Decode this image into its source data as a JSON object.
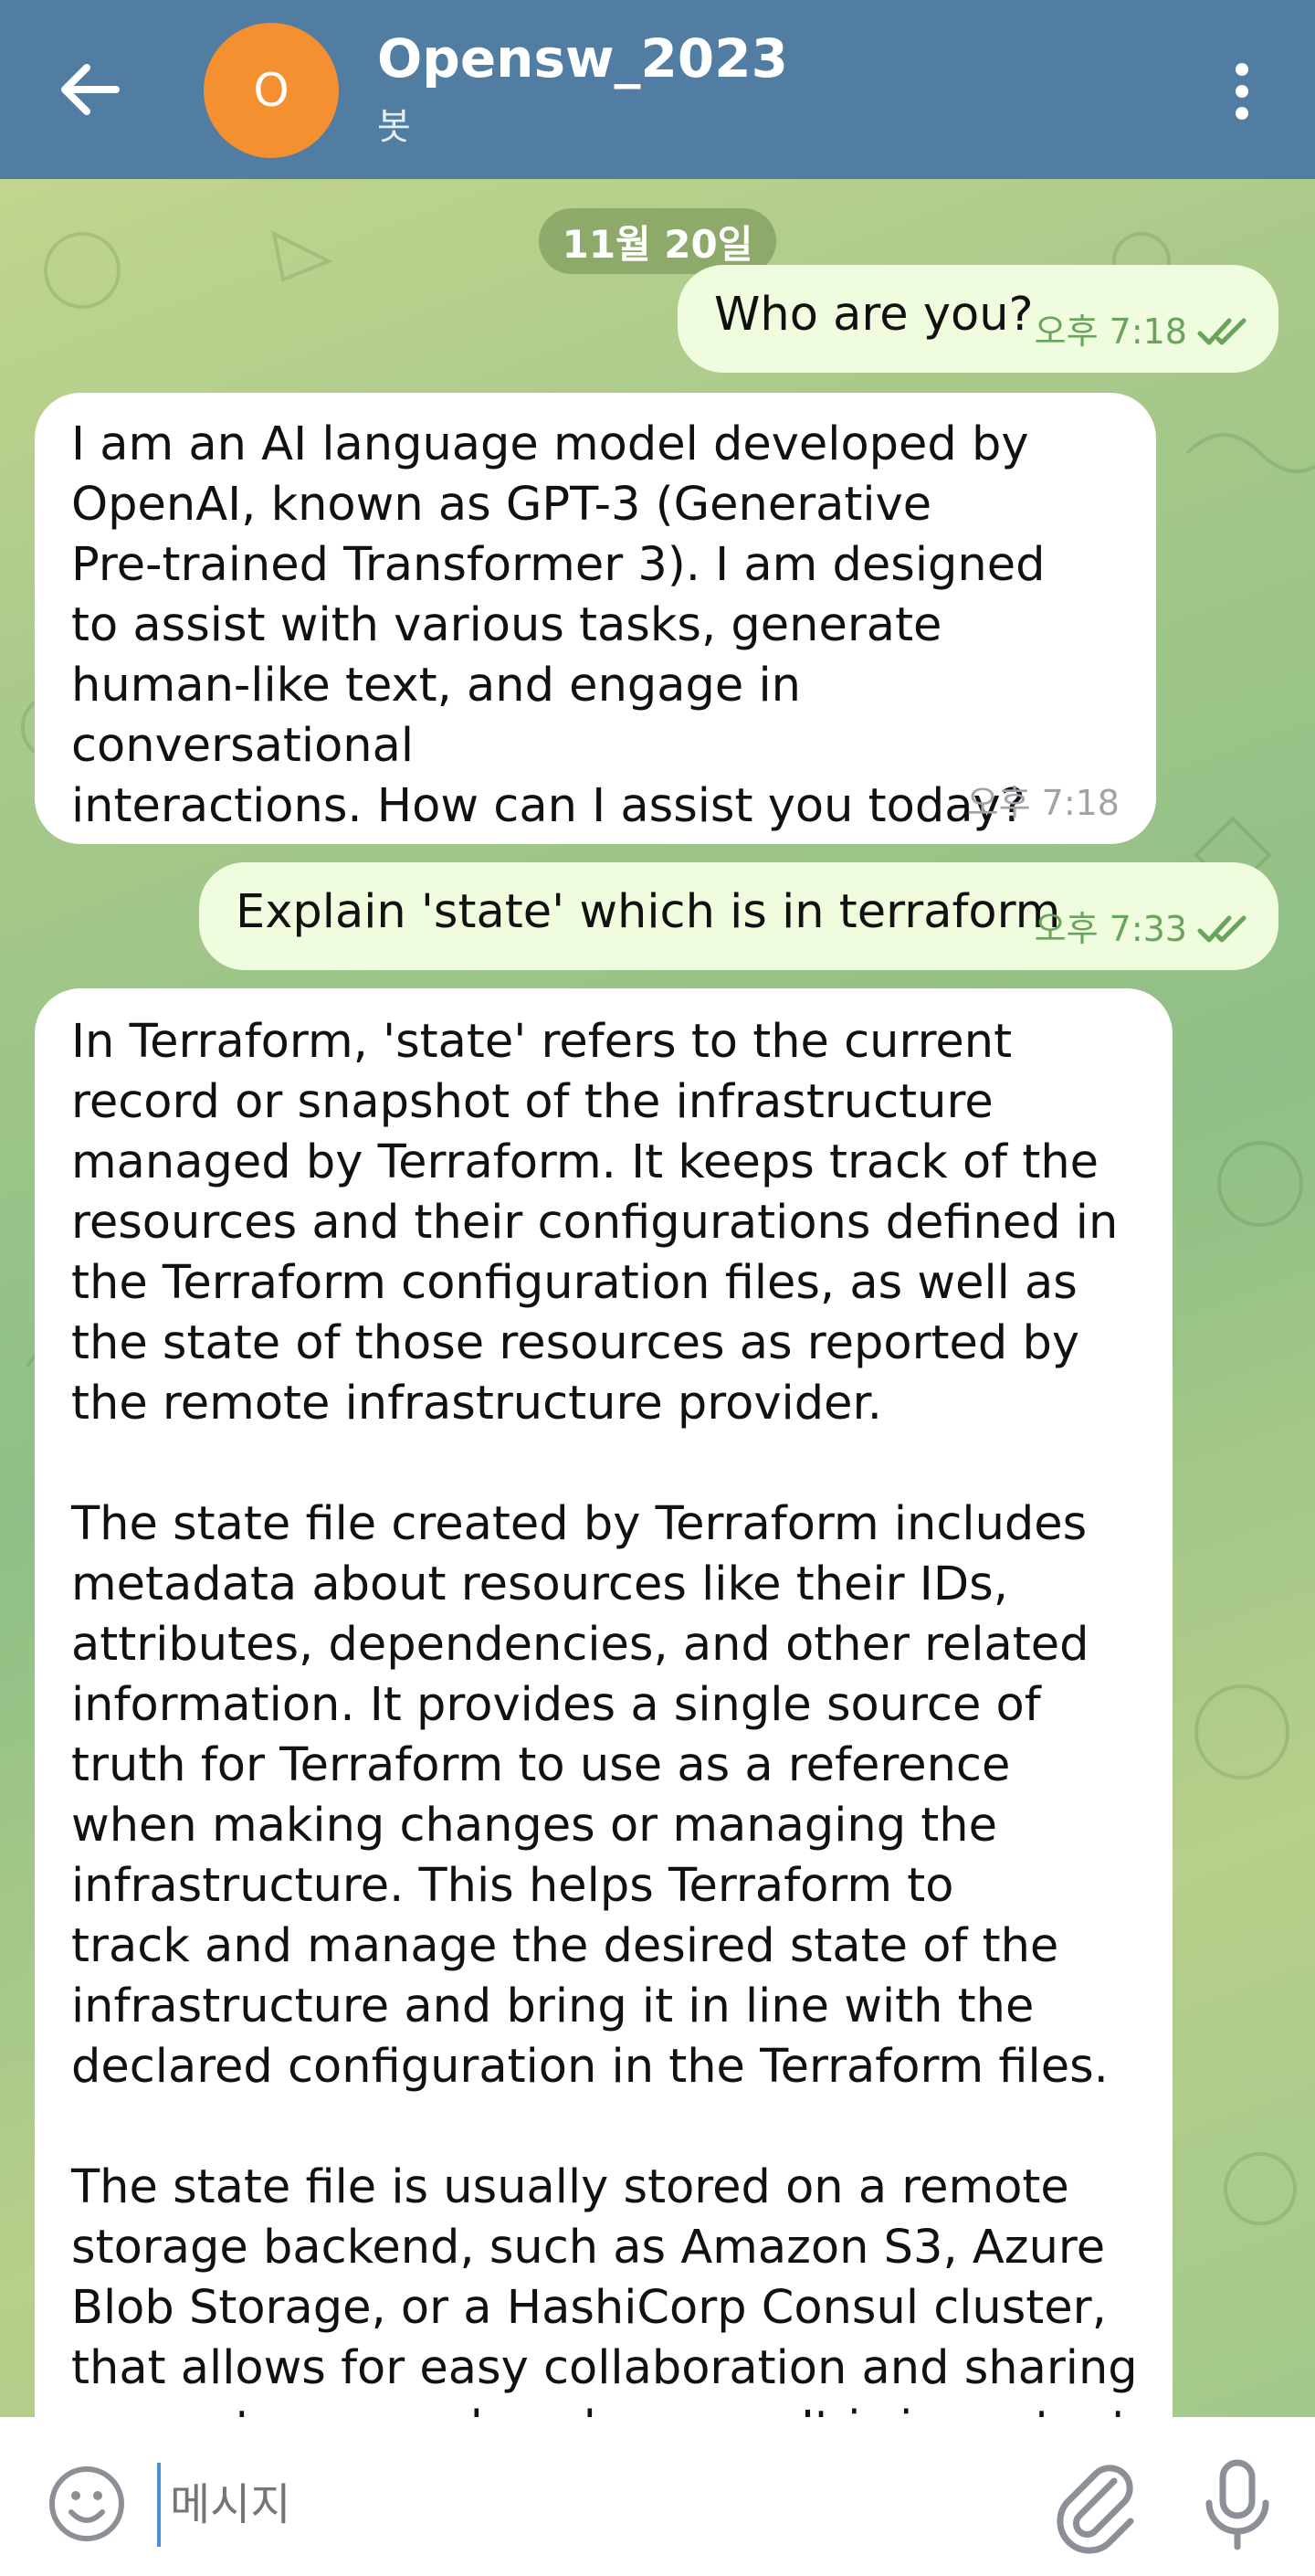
{
  "header": {
    "back_icon": "arrow-left-icon",
    "avatar_letter": "O",
    "avatar_color": "#f4902f",
    "title": "Opensw_2023",
    "subtitle": "봇",
    "menu_icon": "more-vert-icon",
    "bar_color": "#517da2"
  },
  "date_badge": "11월 20일",
  "messages": [
    {
      "direction": "outgoing",
      "text": "Who are you?",
      "time": "오후 7:18",
      "status": "read"
    },
    {
      "direction": "incoming",
      "text": "I am an AI language model developed by\nOpenAI, known as GPT-3 (Generative\nPre-trained Transformer 3). I am designed\nto assist with various tasks, generate\nhuman-like text, and engage in conversational\ninteractions. How can I assist you today?",
      "time": "오후 7:18"
    },
    {
      "direction": "outgoing",
      "text": "Explain 'state' which is in terraform",
      "time": "오후 7:33",
      "status": "read"
    },
    {
      "direction": "incoming",
      "text": "In Terraform, 'state' refers to the current\nrecord or snapshot of the infrastructure\nmanaged by Terraform. It keeps track of the\nresources and their configurations defined in\nthe Terraform configuration files, as well as\nthe state of those resources as reported by\nthe remote infrastructure provider.\n\nThe state file created by Terraform includes\nmetadata about resources like their IDs,\nattributes, dependencies, and other related\ninformation. It provides a single source of\ntruth for Terraform to use as a reference\nwhen making changes or managing the\ninfrastructure. This helps Terraform to\ntrack and manage the desired state of the\ninfrastructure and bring it in line with the\ndeclared configuration in the Terraform files.\n\nThe state file is usually stored on a remote\nstorage backend, such as Amazon S3, Azure\nBlob Storage, or a HashiCorp Consul cluster,\nthat allows for easy collaboration and sharing\nacross teams and workspaces. It is important to handle"
    }
  ],
  "input": {
    "placeholder": "메시지",
    "emoji_icon": "smiley-icon",
    "attach_icon": "paperclip-icon",
    "mic_icon": "microphone-icon"
  },
  "colors": {
    "outgoing_bubble": "#effdde",
    "incoming_bubble": "#ffffff",
    "read_check": "#6aa35c"
  }
}
